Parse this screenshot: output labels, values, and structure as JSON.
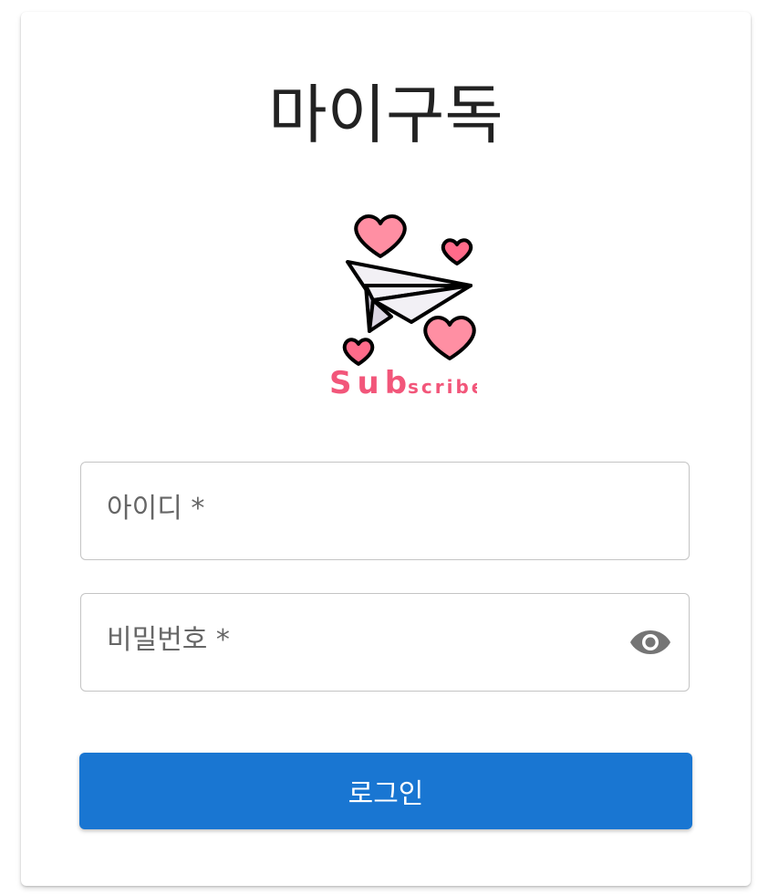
{
  "app": {
    "title": "마이구독"
  },
  "logo": {
    "icon": "paper-plane-hearts-icon",
    "text_large": "Sub",
    "text_small": "scribe",
    "brand_color": "#f2567a"
  },
  "form": {
    "id_field": {
      "label": "아이디 *",
      "value": ""
    },
    "password_field": {
      "label": "비밀번호 *",
      "value": "",
      "toggle_icon": "eye-icon"
    },
    "login_button": {
      "label": "로그인",
      "color": "#1976d2"
    }
  }
}
